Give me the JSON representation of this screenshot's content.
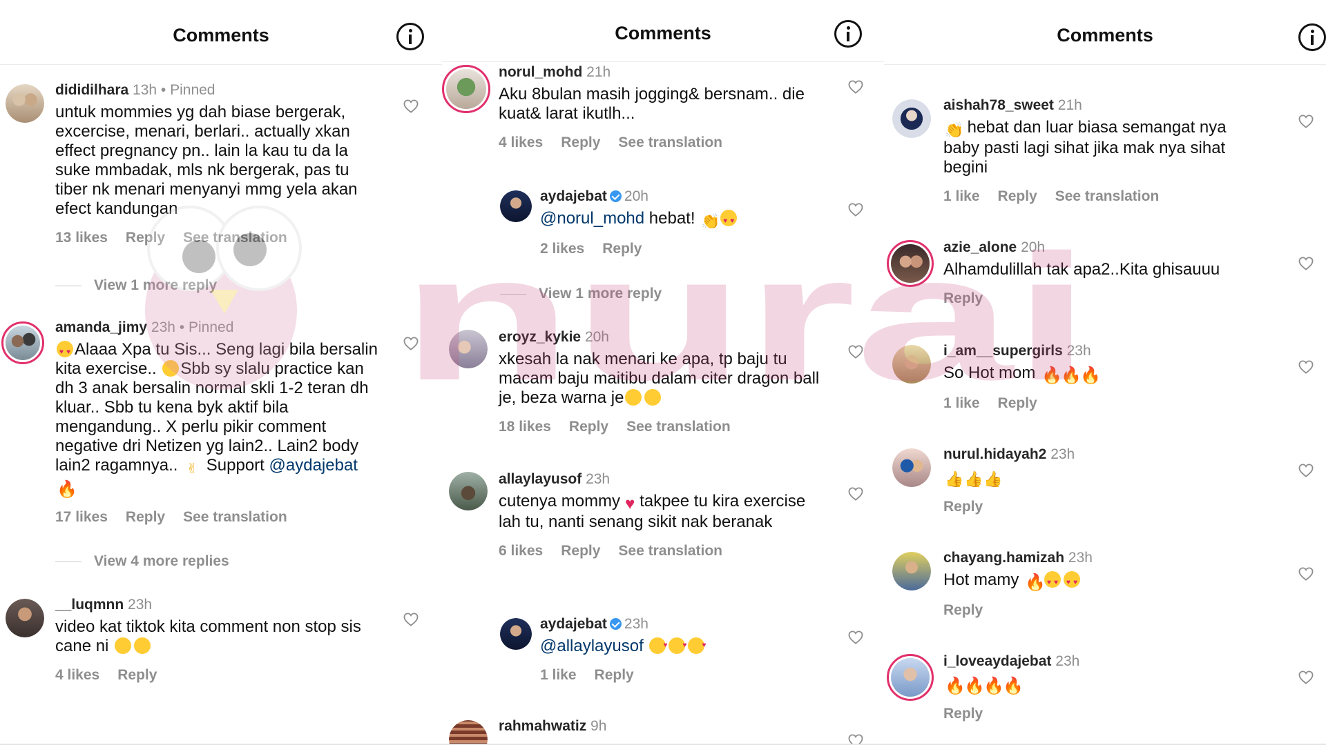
{
  "panels": [
    {
      "header_title": "Comments",
      "comments": [
        {
          "username": "dididilhara",
          "time": "13h",
          "extra": " • Pinned",
          "text": "untuk mommies yg dah biase bergerak, excercise, menari, berlari.. actually xkan effect pregnancy pn.. lain la kau tu da la suke mmbadak, mls nk bergerak, pas tu tiber nk menari menyanyi mmg yela akan efect kandungan",
          "likes": "13 likes",
          "reply": "Reply",
          "translation": "See translation"
        },
        {
          "username": "amanda_jimy",
          "time": "23h",
          "extra": " • Pinned",
          "text_parts": [
            "Alaaa Xpa tu Sis... Seng lagi bila bersalin kita exercise.. ",
            "Sbb sy slalu practice kan dh 3 anak bersalin normal skli 1-2 teran dh kluar.. Sbb tu kena byk aktif bila mengandung.. X perlu pikir comment negative dri Netizen yg lain2.. Lain2 body lain2 ragamnya.. ",
            " Support ",
            "@aydajebat",
            " "
          ],
          "likes": "17 likes",
          "reply": "Reply",
          "translation": "See translation"
        },
        {
          "username": "__luqmnn",
          "time": "23h",
          "text": "video kat tiktok kita comment non stop sis cane ni ",
          "likes": "4 likes",
          "reply": "Reply"
        }
      ],
      "view_more": [
        "View 1 more reply",
        "View 4 more replies"
      ]
    },
    {
      "header_title": "Comments",
      "comments": [
        {
          "username": "norul_mohd",
          "time": "21h",
          "text": "Aku 8bulan masih jogging& bersnam.. die kuat& larat ikutlh...",
          "likes": "4 likes",
          "reply": "Reply",
          "translation": "See translation"
        },
        {
          "username": "aydajebat",
          "time": "20h",
          "mention": "@norul_mohd",
          "text": " hebat! ",
          "likes": "2 likes",
          "reply": "Reply"
        },
        {
          "username": "eroyz_kykie",
          "time": "20h",
          "text": "xkesah la nak menari ke apa, tp baju tu macam baju maitibu dalam citer dragon ball je, beza warna je",
          "likes": "18 likes",
          "reply": "Reply",
          "translation": "See translation"
        },
        {
          "username": "allaylayusof",
          "time": "23h",
          "text_a": "cutenya mommy",
          "text_b": "takpee tu kira exercise lah tu, nanti senang sikit nak beranak",
          "likes": "6 likes",
          "reply": "Reply",
          "translation": "See translation"
        },
        {
          "username": "aydajebat",
          "time": "23h",
          "mention": "@allaylayusof",
          "likes": "1 like",
          "reply": "Reply"
        },
        {
          "username": "rahmahwatiz",
          "time": "9h"
        }
      ],
      "view_more": [
        "View 1 more reply"
      ]
    },
    {
      "header_title": "Comments",
      "comments": [
        {
          "username": "aishah78_sweet",
          "time": "21h",
          "text": " hebat dan luar biasa semangat nya baby pasti lagi sihat jika mak nya sihat begini",
          "likes": "1 like",
          "reply": "Reply",
          "translation": "See translation"
        },
        {
          "username": "azie_alone",
          "time": "20h",
          "text": "Alhamdulillah tak apa2..Kita ghisauuu",
          "reply": "Reply"
        },
        {
          "username": "i_am__supergirls",
          "time": "23h",
          "text": "So Hot mom ",
          "likes": "1 like",
          "reply": "Reply"
        },
        {
          "username": "nurul.hidayah2",
          "time": "23h",
          "reply": "Reply"
        },
        {
          "username": "chayang.hamizah",
          "time": "23h",
          "text": "Hot mamy ",
          "reply": "Reply"
        },
        {
          "username": "i_loveaydajebat",
          "time": "23h",
          "reply": "Reply"
        }
      ]
    }
  ],
  "watermark": "nurai",
  "icons": {
    "info": "info-icon",
    "heart": "heart-outline-icon",
    "verified": "verified-badge-icon"
  },
  "colors": {
    "mention": "#00376b",
    "muted": "#8e8e8e",
    "verified": "#3897f0",
    "story_ring": "#e1306c"
  }
}
